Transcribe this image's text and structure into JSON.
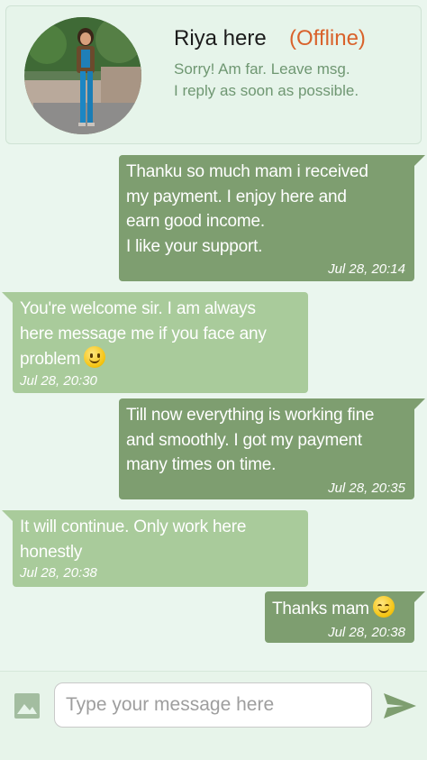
{
  "contact": {
    "name": "Riya here",
    "status": "(Offline)",
    "away_message": "Sorry! Am far. Leave msg.\nI reply as soon as possible."
  },
  "messages": [
    {
      "direction": "out",
      "text": "Thanku so much mam i received\nmy payment. I enjoy here and\nearn good income.\nI like your support.",
      "time": "Jul 28, 20:14"
    },
    {
      "direction": "in",
      "text": "You're welcome sir. I am always\nhere  message me if you face any\nproblem",
      "emoji": "slightly-smiling-face",
      "time": "Jul 28, 20:30"
    },
    {
      "direction": "out",
      "text": "Till now everything is working fine\nand smoothly. I got my payment\nmany times on time.",
      "time": "Jul 28, 20:35"
    },
    {
      "direction": "in",
      "text": "It will continue. Only work here\nhonestly",
      "time": "Jul 28, 20:38"
    },
    {
      "direction": "out",
      "text": "Thanks mam",
      "emoji": "smiling-face-with-smiling-eyes",
      "time": "Jul 28, 20:38"
    }
  ],
  "composer": {
    "placeholder": "Type your message here",
    "value": ""
  },
  "icons": {
    "attach": "gallery-icon",
    "send": "send-icon"
  },
  "colors": {
    "background": "#eaf6ee",
    "outgoing_bubble": "#7e9e70",
    "incoming_bubble": "#a9cb9b",
    "status_offline": "#d9622b",
    "away_text": "#6f9772"
  }
}
